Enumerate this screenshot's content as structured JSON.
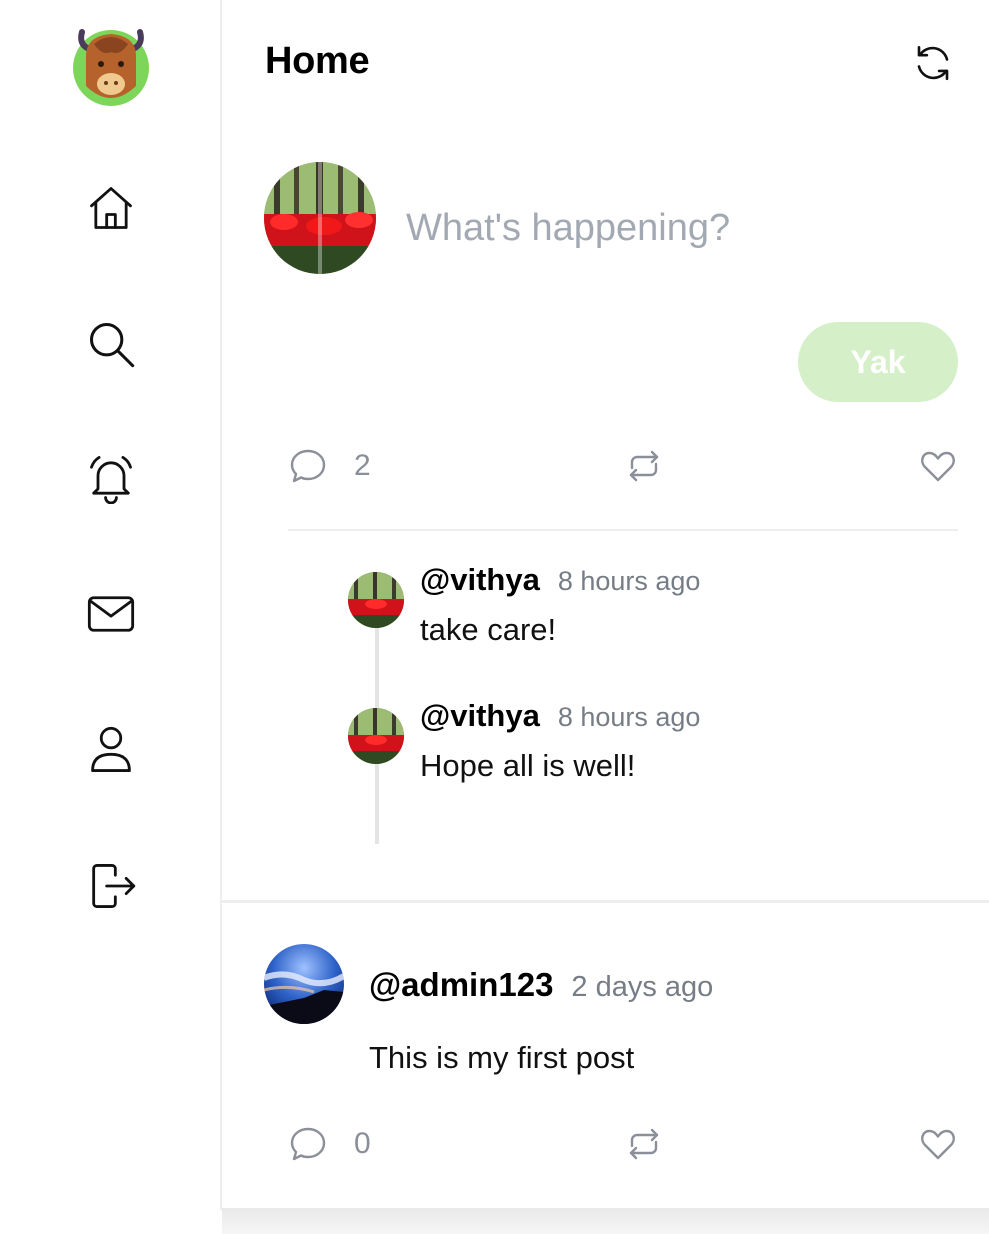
{
  "sidebar": {
    "logo": "bison-logo-icon",
    "items": [
      {
        "name": "home",
        "icon": "home-icon"
      },
      {
        "name": "explore",
        "icon": "search-icon"
      },
      {
        "name": "notifications",
        "icon": "bell-icon"
      },
      {
        "name": "messages",
        "icon": "mail-icon"
      },
      {
        "name": "profile",
        "icon": "user-icon"
      },
      {
        "name": "logout",
        "icon": "logout-icon"
      }
    ]
  },
  "header": {
    "title": "Home",
    "refresh_icon": "refresh-icon"
  },
  "composer": {
    "placeholder": "What's happening?",
    "button_label": "Yak"
  },
  "feed": {
    "thread": {
      "comment_count": "2",
      "replies": [
        {
          "handle": "@vithya",
          "time": "8 hours ago",
          "text": "take care!"
        },
        {
          "handle": "@vithya",
          "time": "8 hours ago",
          "text": "Hope all is well!"
        }
      ]
    },
    "post": {
      "handle": "@admin123",
      "time": "2 days ago",
      "text": "This is my first post",
      "comment_count": "0"
    }
  },
  "colors": {
    "accent": "#d5f0c8",
    "muted": "#8a8f99",
    "divider": "#eeeeee",
    "placeholder": "#a3a9b3"
  }
}
